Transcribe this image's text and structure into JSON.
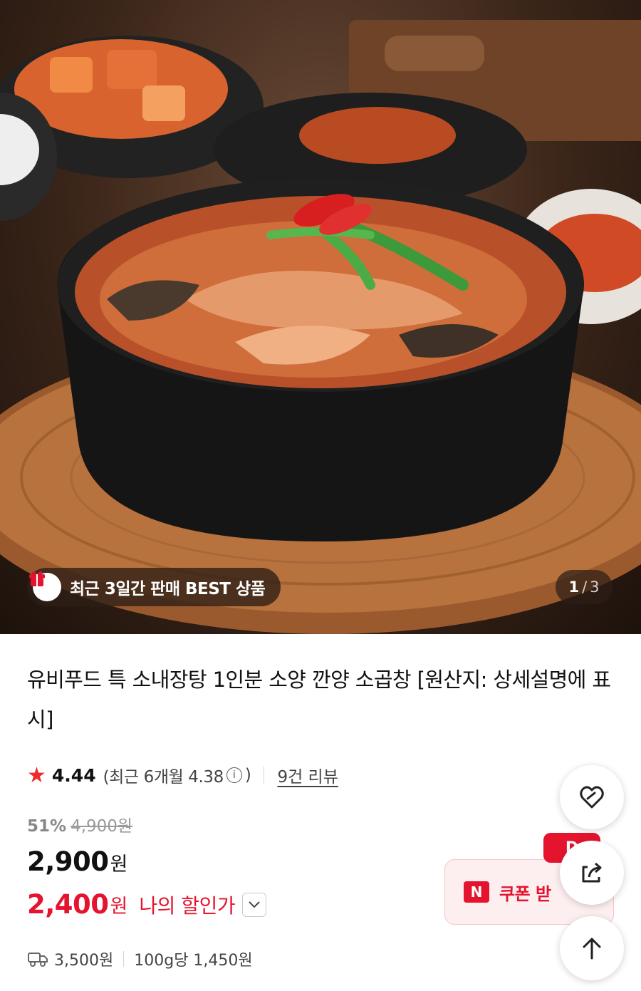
{
  "hero": {
    "best_badge": "최근 3일간 판매 BEST 상품",
    "image_counter": {
      "current": "1",
      "separator": "/",
      "total": "3"
    }
  },
  "product": {
    "title": "유비푸드 특 소내장탕 1인분 소양 깐양 소곱창 [원산지: 상세설명에 표시]",
    "rating": {
      "score": "4.44",
      "recent_prefix": "(최근 6개월 4.38",
      "recent_suffix": ")",
      "review_count": "9건 리뷰"
    },
    "discount_rate": "51%",
    "original_price": "4,900원",
    "price": "2,900",
    "price_unit": "원",
    "my_price": "2,400",
    "my_price_unit": "원",
    "my_price_label": "나의 할인가",
    "shipping_fee": "3,500원",
    "unit_price": "100g당 1,450원"
  },
  "coupon": {
    "logo": "N",
    "label": "쿠폰 받",
    "badge": "D"
  },
  "colors": {
    "accent_red": "#e5142e",
    "star": "#ef2b2a"
  },
  "icons": {
    "gift": "gift-icon",
    "star": "star-icon",
    "info": "info-icon",
    "chevron": "chevron-down-icon",
    "truck": "truck-icon",
    "heart": "heart-icon",
    "share": "share-icon",
    "top": "arrow-up-icon"
  }
}
